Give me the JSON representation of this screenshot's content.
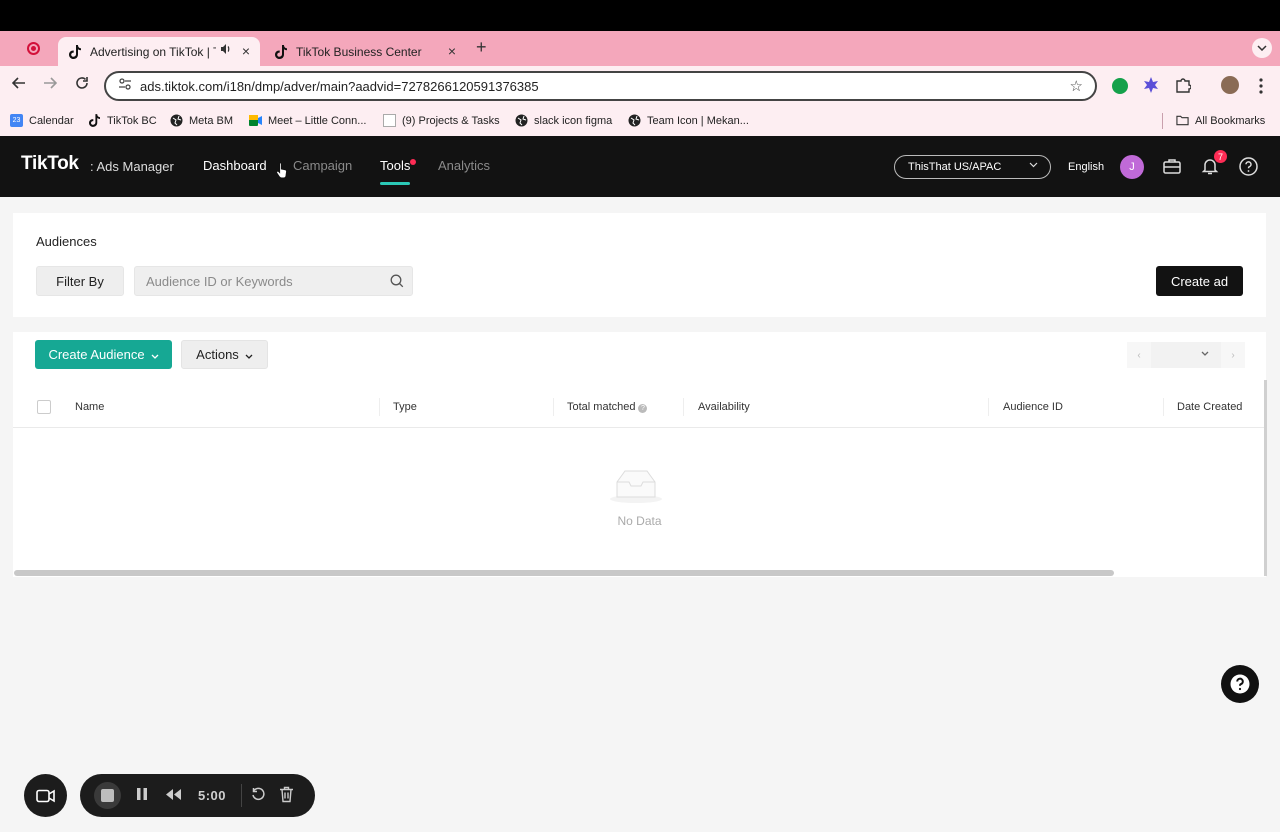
{
  "browser": {
    "tabs": [
      {
        "title": "Advertising on TikTok | Tik",
        "active": true,
        "sound": true
      },
      {
        "title": "TikTok Business Center",
        "active": false
      }
    ],
    "new_tab": "+",
    "tab_close": "×",
    "url": "ads.tiktok.com/i18n/dmp/adver/main?aadvid=7278266120591376385",
    "bookmarks": [
      {
        "label": "Calendar",
        "icon": "calendar-icon"
      },
      {
        "label": "TikTok BC",
        "icon": "tiktok-icon"
      },
      {
        "label": "Meta BM",
        "icon": "globe-icon"
      },
      {
        "label": "Meet – Little Conn...",
        "icon": "meet-icon"
      },
      {
        "label": "(9) Projects & Tasks",
        "icon": "doc-icon"
      },
      {
        "label": "slack icon figma",
        "icon": "globe-icon"
      },
      {
        "label": "Team Icon | Mekan...",
        "icon": "globe-icon"
      }
    ],
    "all_bookmarks": "All Bookmarks"
  },
  "header": {
    "logo": "TikTok",
    "product": ": Ads Manager",
    "nav": [
      {
        "label": "Dashboard",
        "state": "normal"
      },
      {
        "label": "Campaign",
        "state": "dim"
      },
      {
        "label": "Tools",
        "state": "active"
      },
      {
        "label": "Analytics",
        "state": "dim"
      }
    ],
    "account": "ThisThat US/APAC",
    "language": "English",
    "avatar_initial": "J",
    "notification_count": "7"
  },
  "audiences": {
    "title": "Audiences",
    "filter_label": "Filter By",
    "search_placeholder": "Audience ID or Keywords",
    "create_ad_label": "Create ad"
  },
  "table": {
    "create_audience_label": "Create Audience",
    "actions_label": "Actions",
    "columns": [
      "Name",
      "Type",
      "Total matched",
      "Availability",
      "Audience ID",
      "Date Created"
    ],
    "empty_text": "No Data"
  },
  "recorder": {
    "time": "5:00"
  },
  "colors": {
    "tab_strip": "#f4a7bb",
    "tiktok_header": "#121212",
    "accent_teal": "#16a894",
    "tools_underline": "#2bc8b6",
    "badge_red": "#fe2c55"
  }
}
